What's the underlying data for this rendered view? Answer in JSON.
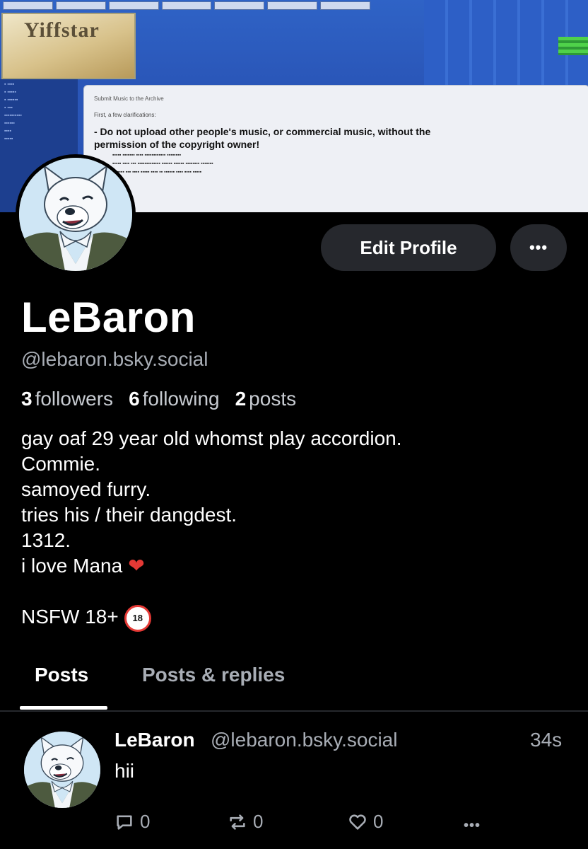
{
  "banner": {
    "logo_text": "Yiffstar",
    "panel_title": "Submit Music to the Archive",
    "panel_intro": "First, a few clarifications:",
    "panel_rule_1": "- Do not upload other people's music, or commercial music, without the",
    "panel_rule_2": "permission of the copyright owner!"
  },
  "profile": {
    "display_name": "LeBaron",
    "handle": "@lebaron.bsky.social",
    "edit_label": "Edit Profile",
    "more_label": "•••",
    "stats": {
      "followers_count": "3",
      "followers_label": "followers",
      "following_count": "6",
      "following_label": "following",
      "posts_count": "2",
      "posts_label": "posts"
    },
    "bio_lines": [
      "gay oaf 29 year old whomst play accordion.",
      "Commie.",
      "samoyed furry.",
      "tries his / their dangdest.",
      "1312.",
      "i love Mana"
    ],
    "bio_nsfw": "NSFW 18+",
    "heart_icon": "❤",
    "age_badge_text": "18"
  },
  "tabs": [
    {
      "label": "Posts",
      "active": true
    },
    {
      "label": "Posts & replies",
      "active": false
    }
  ],
  "post": {
    "author_name": "LeBaron",
    "author_handle": "@lebaron.bsky.social",
    "time": "34s",
    "text": "hii",
    "reply_count": "0",
    "repost_count": "0",
    "like_count": "0",
    "more_label": "•••"
  },
  "colors": {
    "background": "#000000",
    "button_bg": "#26282d",
    "muted_text": "#a8adb5",
    "heart": "#e53935"
  }
}
